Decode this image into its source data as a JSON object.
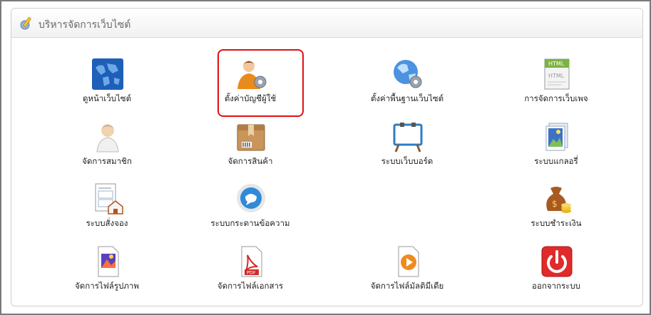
{
  "panel": {
    "title": "บริหารจัดการเว็บไซต์",
    "header_icon": "pencil-settings-icon"
  },
  "items": [
    {
      "label": "ดูหน้าเว็บไซต์",
      "icon": "globe-icon"
    },
    {
      "label": "ตั้งค่าบัญชีผู้ใช้",
      "icon": "user-settings-icon"
    },
    {
      "label": "ตั้งค่าพื้นฐานเว็บไซต์",
      "icon": "globe-settings-icon"
    },
    {
      "label": "การจัดการเว็บเพจ",
      "icon": "html-page-icon"
    },
    {
      "label": "จัดการสมาชิก",
      "icon": "member-icon"
    },
    {
      "label": "จัดการสินค้า",
      "icon": "product-box-icon"
    },
    {
      "label": "ระบบเว็บบอร์ด",
      "icon": "webboard-icon"
    },
    {
      "label": "ระบบแกลอรี่",
      "icon": "gallery-icon"
    },
    {
      "label": "ระบบสั่งจอง",
      "icon": "booking-form-icon"
    },
    {
      "label": "ระบบกระดานข้อความ",
      "icon": "message-bubble-icon"
    },
    {
      "label": "ระบบชำระเงิน",
      "icon": "money-bag-icon"
    },
    {
      "label": "จัดการไฟล์รูปภาพ",
      "icon": "image-file-icon"
    },
    {
      "label": "จัดการไฟล์เอกสาร",
      "icon": "pdf-file-icon"
    },
    {
      "label": "จัดการไฟล์มัลติมีเดีย",
      "icon": "media-file-icon"
    },
    {
      "label": "ออกจากระบบ",
      "icon": "power-icon"
    }
  ],
  "highlighted_item": "ตั้งค่าบัญชีผู้ใช้",
  "colors": {
    "highlight_border": "#e01010"
  }
}
